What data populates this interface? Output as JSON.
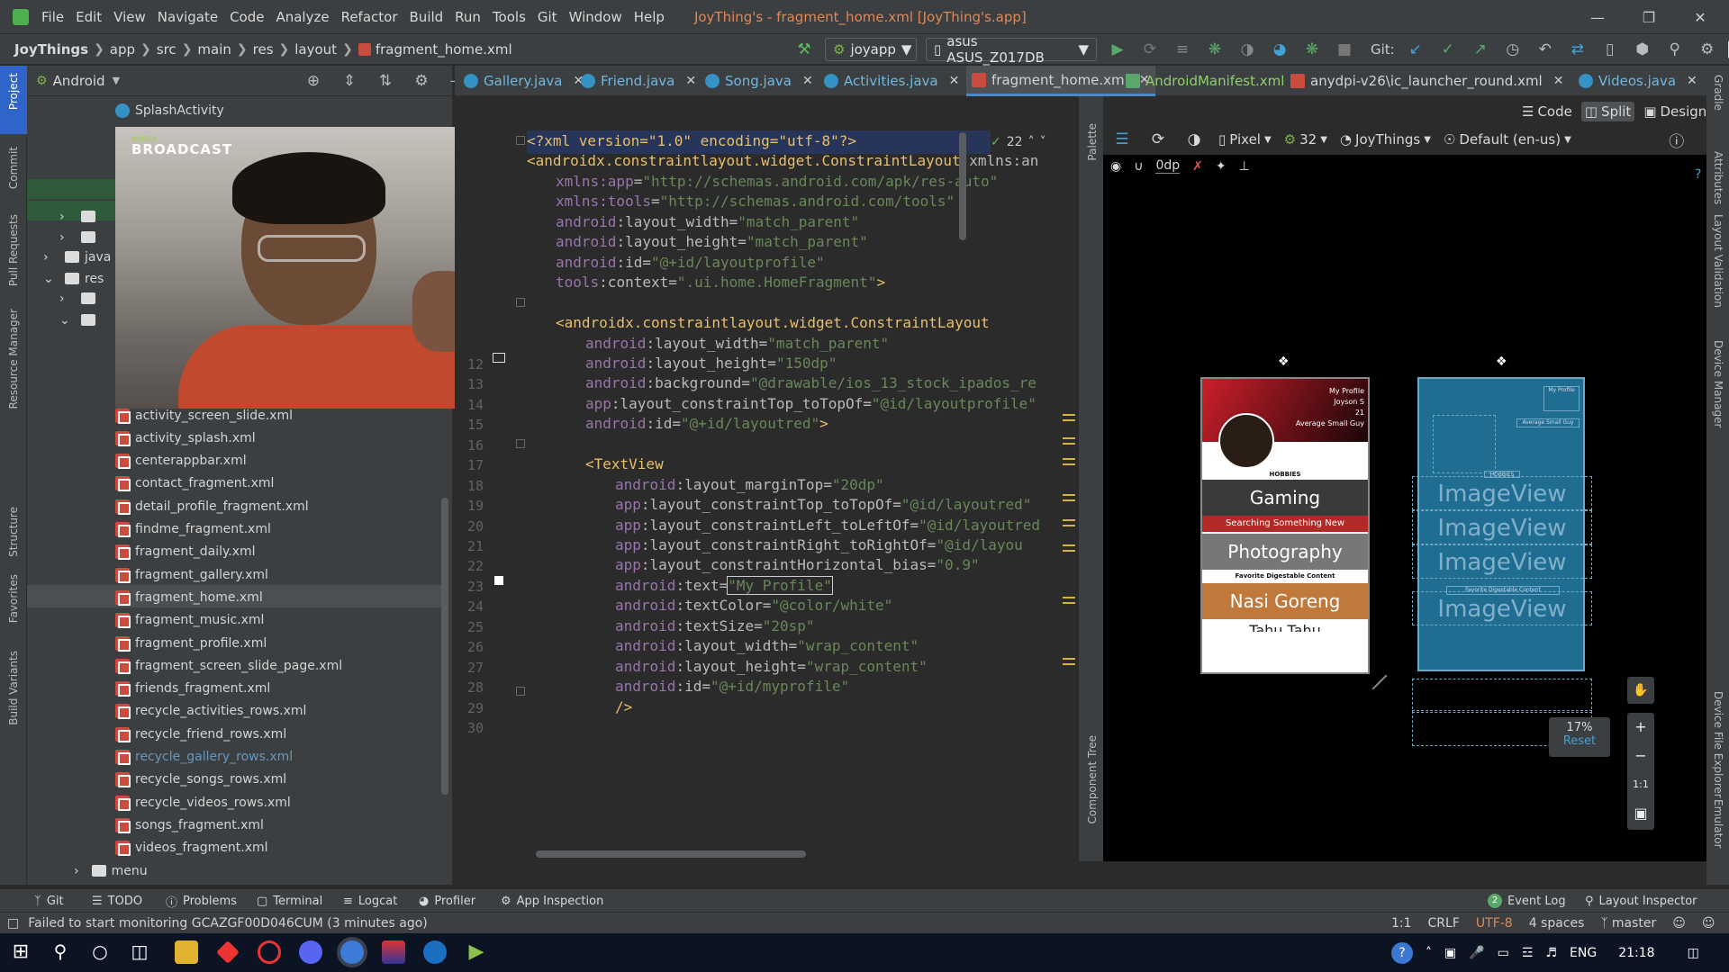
{
  "menubar": {
    "items": [
      "File",
      "Edit",
      "View",
      "Navigate",
      "Code",
      "Analyze",
      "Refactor",
      "Build",
      "Run",
      "Tools",
      "Git",
      "Window",
      "Help"
    ],
    "title": "JoyThing's - fragment_home.xml [JoyThing's.app]"
  },
  "navbar": {
    "crumbs": [
      "JoyThings",
      "app",
      "src",
      "main",
      "res",
      "layout",
      "fragment_home.xml"
    ],
    "run_config": "joyapp",
    "device": "asus ASUS_Z017DB",
    "git_label": "Git:"
  },
  "left_strip": [
    "Project",
    "Commit",
    "Pull Requests",
    "Resource Manager",
    "Structure",
    "Favorites",
    "Build Variants"
  ],
  "project": {
    "view_mode": "Android",
    "top_items": [
      {
        "label": "SplashActivity"
      }
    ],
    "folders": [
      "java",
      "res"
    ],
    "files": [
      "activity_screen_slide.xml",
      "activity_splash.xml",
      "centerappbar.xml",
      "contact_fragment.xml",
      "detail_profile_fragment.xml",
      "findme_fragment.xml",
      "fragment_daily.xml",
      "fragment_gallery.xml",
      "fragment_home.xml",
      "fragment_music.xml",
      "fragment_profile.xml",
      "fragment_screen_slide_page.xml",
      "friends_fragment.xml",
      "recycle_activities_rows.xml",
      "recycle_friend_rows.xml",
      "recycle_gallery_rows.xml",
      "recycle_songs_rows.xml",
      "recycle_videos_rows.xml",
      "songs_fragment.xml",
      "videos_fragment.xml"
    ],
    "selected_file": "fragment_home.xml",
    "modified_file": "recycle_gallery_rows.xml",
    "bottom_folder": "menu"
  },
  "webcam": {
    "brand_small": "NVIDIA",
    "brand": "BROADCAST"
  },
  "tabs": [
    {
      "label": "Gallery.java"
    },
    {
      "label": "Friend.java"
    },
    {
      "label": "Song.java"
    },
    {
      "label": "Activities.java"
    },
    {
      "label": "fragment_home.xml",
      "active": true
    },
    {
      "label": "AndroidManifest.xml"
    },
    {
      "label": "anydpi-v26\\ic_launcher_round.xml"
    },
    {
      "label": "Videos.java"
    }
  ],
  "view_modes": {
    "code": "Code",
    "split": "Split",
    "design": "Design"
  },
  "editor": {
    "warnings": "22",
    "lines": [
      {
        "n": "",
        "parts": [
          [
            "tag",
            "<?xml version=\"1.0\" encoding=\"utf-8\"?>"
          ]
        ]
      },
      {
        "n": "",
        "parts": [
          [
            "tag",
            "<androidx.constraintlayout.widget.ConstraintLayout "
          ],
          [
            "attr",
            "xmlns:an"
          ]
        ]
      },
      {
        "n": "",
        "parts": [
          [
            "ns",
            "xmlns:app"
          ],
          [
            "attr",
            "="
          ],
          [
            "val",
            "\"http://schemas.android.com/apk/res-auto\""
          ]
        ]
      },
      {
        "n": "",
        "parts": [
          [
            "ns",
            "xmlns:tools"
          ],
          [
            "attr",
            "="
          ],
          [
            "val",
            "\"http://schemas.android.com/tools\""
          ]
        ]
      },
      {
        "n": "",
        "parts": [
          [
            "ns",
            "android"
          ],
          [
            "attr",
            ":layout_width="
          ],
          [
            "val",
            "\"match_parent\""
          ]
        ]
      },
      {
        "n": "",
        "parts": [
          [
            "ns",
            "android"
          ],
          [
            "attr",
            ":layout_height="
          ],
          [
            "val",
            "\"match_parent\""
          ]
        ]
      },
      {
        "n": "",
        "parts": [
          [
            "ns",
            "android"
          ],
          [
            "attr",
            ":id="
          ],
          [
            "val",
            "\"@+id/layoutprofile\""
          ]
        ]
      },
      {
        "n": "",
        "parts": [
          [
            "ns",
            "tools"
          ],
          [
            "attr",
            ":context="
          ],
          [
            "val",
            "\".ui.home.HomeFragment\""
          ],
          [
            "tag",
            ">"
          ]
        ]
      },
      {
        "n": "",
        "parts": []
      },
      {
        "n": "",
        "parts": [
          [
            "tag",
            "<androidx.constraintlayout.widget.ConstraintLayout"
          ]
        ]
      },
      {
        "n": "",
        "parts": [
          [
            "ns",
            "android"
          ],
          [
            "attr",
            ":layout_width="
          ],
          [
            "val",
            "\"match_parent\""
          ]
        ]
      },
      {
        "n": "12",
        "parts": [
          [
            "ns",
            "android"
          ],
          [
            "attr",
            ":layout_height="
          ],
          [
            "val",
            "\"150dp\""
          ]
        ]
      },
      {
        "n": "13",
        "parts": [
          [
            "ns",
            "android"
          ],
          [
            "attr",
            ":background="
          ],
          [
            "val",
            "\"@drawable/ios_13_stock_ipados_re"
          ]
        ]
      },
      {
        "n": "14",
        "parts": [
          [
            "ns",
            "app"
          ],
          [
            "attr",
            ":layout_constraintTop_toTopOf="
          ],
          [
            "val",
            "\"@id/layoutprofile\""
          ]
        ]
      },
      {
        "n": "15",
        "parts": [
          [
            "ns",
            "android"
          ],
          [
            "attr",
            ":id="
          ],
          [
            "val",
            "\"@+id/layoutred\""
          ],
          [
            "tag",
            ">"
          ]
        ]
      },
      {
        "n": "16",
        "parts": []
      },
      {
        "n": "17",
        "parts": [
          [
            "tag",
            "<TextView"
          ]
        ]
      },
      {
        "n": "18",
        "parts": [
          [
            "ns",
            "android"
          ],
          [
            "attr",
            ":layout_marginTop="
          ],
          [
            "val",
            "\"20dp\""
          ]
        ]
      },
      {
        "n": "19",
        "parts": [
          [
            "ns",
            "app"
          ],
          [
            "attr",
            ":layout_constraintTop_toTopOf="
          ],
          [
            "val",
            "\"@id/layoutred\""
          ]
        ]
      },
      {
        "n": "20",
        "parts": [
          [
            "ns",
            "app"
          ],
          [
            "attr",
            ":layout_constraintLeft_toLeftOf="
          ],
          [
            "val",
            "\"@id/layoutred"
          ]
        ]
      },
      {
        "n": "21",
        "parts": [
          [
            "ns",
            "app"
          ],
          [
            "attr",
            ":layout_constraintRight_toRightOf="
          ],
          [
            "val",
            "\"@id/layou"
          ]
        ]
      },
      {
        "n": "22",
        "parts": [
          [
            "ns",
            "app"
          ],
          [
            "attr",
            ":layout_constraintHorizontal_bias="
          ],
          [
            "val",
            "\"0.9\""
          ]
        ]
      },
      {
        "n": "23",
        "parts": [
          [
            "ns",
            "android"
          ],
          [
            "attr",
            ":text="
          ],
          [
            "val",
            "\"My Profile\""
          ]
        ]
      },
      {
        "n": "24",
        "parts": [
          [
            "ns",
            "android"
          ],
          [
            "attr",
            ":textColor="
          ],
          [
            "val",
            "\"@color/white\""
          ]
        ]
      },
      {
        "n": "25",
        "parts": [
          [
            "ns",
            "android"
          ],
          [
            "attr",
            ":textSize="
          ],
          [
            "val",
            "\"20sp\""
          ]
        ]
      },
      {
        "n": "26",
        "parts": [
          [
            "ns",
            "android"
          ],
          [
            "attr",
            ":layout_width="
          ],
          [
            "val",
            "\"wrap_content\""
          ]
        ]
      },
      {
        "n": "27",
        "parts": [
          [
            "ns",
            "android"
          ],
          [
            "attr",
            ":layout_height="
          ],
          [
            "val",
            "\"wrap_content\""
          ]
        ]
      },
      {
        "n": "28",
        "parts": [
          [
            "ns",
            "android"
          ],
          [
            "attr",
            ":id="
          ],
          [
            "val",
            "\"@+id/myprofile\""
          ]
        ]
      },
      {
        "n": "29",
        "parts": [
          [
            "tag",
            "/>"
          ]
        ]
      },
      {
        "n": "30",
        "parts": []
      }
    ]
  },
  "design_toolbar": {
    "device": "Pixel",
    "api": "32",
    "theme": "JoyThings",
    "locale": "Default (en-us)",
    "margin": "0dp"
  },
  "palette_label": "Palette",
  "component_tree_label": "Component Tree",
  "right_strip": [
    "Gradle",
    "Attributes",
    "Layout Validation",
    "Device Manager",
    "Device File Explorer",
    "Emulator"
  ],
  "phone_preview": {
    "profile_label": "My Profile",
    "name": "Joyson S",
    "age": "21",
    "subtitle": "Average Small Guy",
    "hobbies": "HOBBIES",
    "gaming": "Gaming",
    "searching": "Searching Something New",
    "photography": "Photography",
    "favorite": "Favorite Digestable Content",
    "nasi": "Nasi Goreng",
    "tahu": "Tahu Tahu"
  },
  "blueprint": {
    "imageview": "ImageView",
    "profile": "My Profile",
    "hobbies": "HOBBIES",
    "favorite": "Favorite Digestable Content",
    "average": "Average Small Guy"
  },
  "zoom": {
    "level": "17%",
    "reset": "Reset",
    "one_to_one": "1:1"
  },
  "toolwindows": {
    "git": "Git",
    "todo": "TODO",
    "problems": "Problems",
    "terminal": "Terminal",
    "logcat": "Logcat",
    "profiler": "Profiler",
    "app_inspection": "App Inspection",
    "event_log": "Event Log",
    "event_count": "2",
    "layout_inspector": "Layout Inspector"
  },
  "status": {
    "message": "Failed to start monitoring GCAZGF00D046CUM (3 minutes ago)",
    "pos": "1:1",
    "eol": "CRLF",
    "enc": "UTF-8",
    "indent": "4 spaces",
    "branch": "master"
  },
  "taskbar": {
    "lang": "ENG",
    "time": "21:18"
  }
}
